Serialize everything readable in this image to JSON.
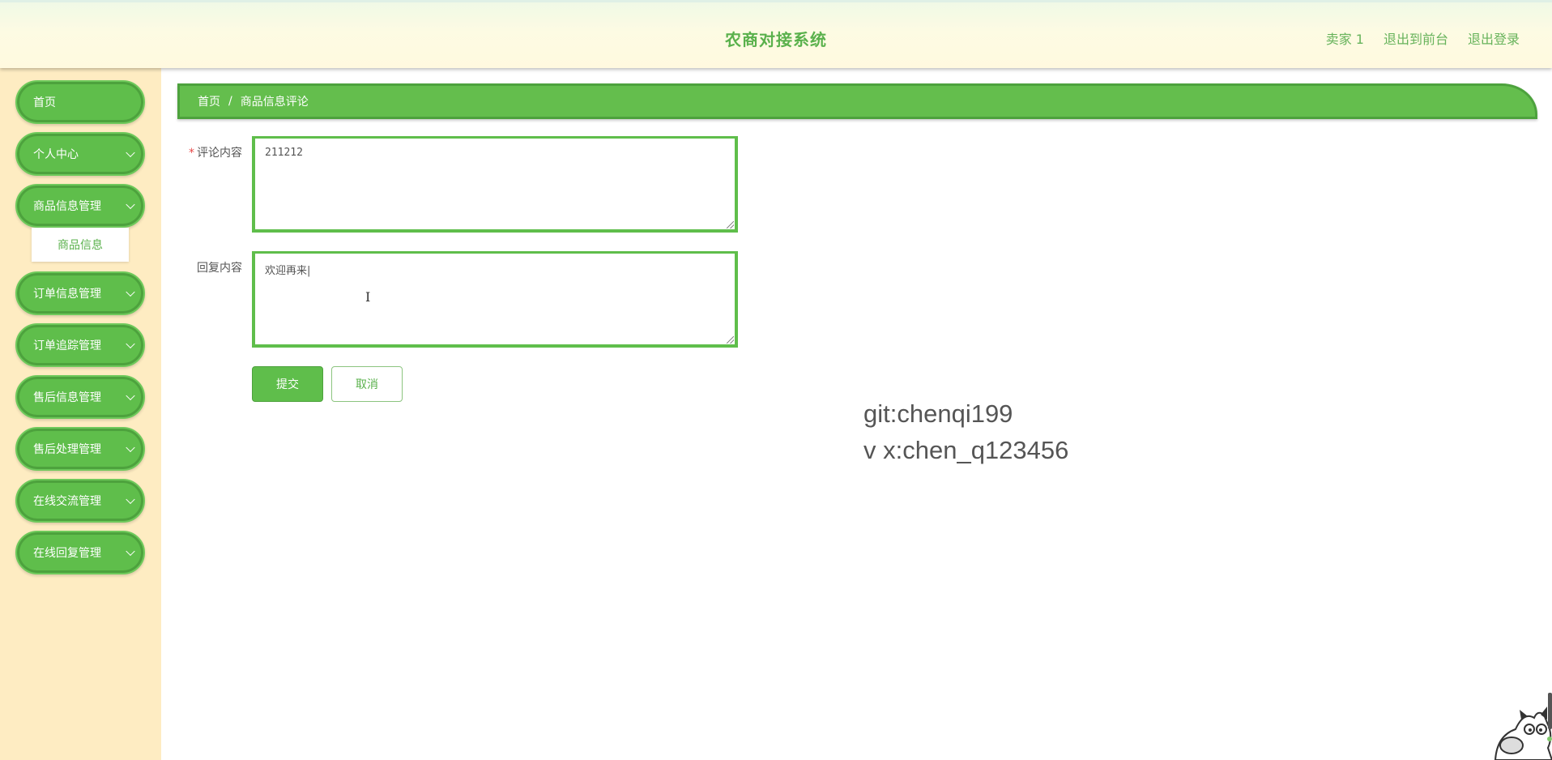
{
  "header": {
    "title": "农商对接系统",
    "user": "卖家 1",
    "to_front": "退出到前台",
    "logout": "退出登录"
  },
  "sidebar": {
    "items": [
      {
        "label": "首页",
        "has_chevron": false
      },
      {
        "label": "个人中心",
        "has_chevron": true
      },
      {
        "label": "商品信息管理",
        "has_chevron": true
      },
      {
        "label": "订单信息管理",
        "has_chevron": true
      },
      {
        "label": "订单追踪管理",
        "has_chevron": true
      },
      {
        "label": "售后信息管理",
        "has_chevron": true
      },
      {
        "label": "售后处理管理",
        "has_chevron": true
      },
      {
        "label": "在线交流管理",
        "has_chevron": true
      },
      {
        "label": "在线回复管理",
        "has_chevron": true
      }
    ],
    "submenu": {
      "label": "商品信息"
    }
  },
  "breadcrumb": {
    "home": "首页",
    "separator": "/",
    "current": "商品信息评论"
  },
  "form": {
    "comment_label": "评论内容",
    "comment_required_mark": "*",
    "comment_value": "211212",
    "reply_label": "回复内容",
    "reply_value": "欢迎再来|",
    "submit_label": "提交",
    "cancel_label": "取消"
  },
  "watermark": {
    "line1": "git:chenqi199",
    "line2": "v x:chen_q123456"
  },
  "colors": {
    "accent": "#5fbe4b",
    "accent_dark": "#4da23d",
    "sidebar_bg": "#feecc2",
    "title": "#5ab14c"
  }
}
